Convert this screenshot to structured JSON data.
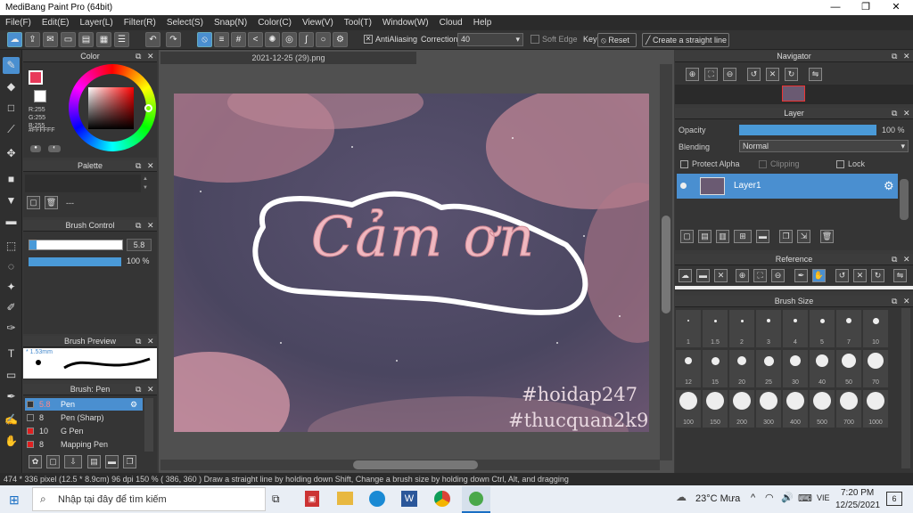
{
  "window": {
    "title": "MediBang Paint Pro (64bit)",
    "minimize": "—",
    "maximize": "❐",
    "close": "✕"
  },
  "menu": [
    "File(F)",
    "Edit(E)",
    "Layer(L)",
    "Filter(R)",
    "Select(S)",
    "Snap(N)",
    "Color(C)",
    "View(V)",
    "Tool(T)",
    "Window(W)",
    "Cloud",
    "Help"
  ],
  "toolbar": {
    "antialias_label": "AntiAliasing",
    "correction_label": "Correction",
    "correction_value": "40",
    "soft_edge_label": "Soft Edge",
    "key_label": "Key",
    "reset_label": "Reset",
    "straight_line_label": "Create a straight line"
  },
  "panels": {
    "color": "Color",
    "palette": "Palette",
    "brush_control": "Brush Control",
    "brush_preview": "Brush Preview",
    "brush_list": "Brush: Pen",
    "navigator": "Navigator",
    "layer": "Layer",
    "reference": "Reference",
    "brush_size": "Brush Size"
  },
  "color": {
    "r": "R:255",
    "g": "G:255",
    "b": "B:255",
    "hex": "#FFFFFF",
    "foreground": "#e83a5a",
    "wheel_selected": "#ff0000"
  },
  "palette": {
    "none_label": "---"
  },
  "brush_control": {
    "size": "5.8",
    "opacity": "100 %",
    "size_fraction": 0.66,
    "opacity_fraction": 1.0
  },
  "brush_preview": {
    "size_label": "* 1.53mm"
  },
  "brushes": [
    {
      "size": "5.8",
      "name": "Pen",
      "color": "#333333",
      "selected": true
    },
    {
      "size": "8",
      "name": "Pen (Sharp)",
      "color": "#333333",
      "selected": false
    },
    {
      "size": "10",
      "name": "G Pen",
      "color": "#e02020",
      "selected": false
    },
    {
      "size": "8",
      "name": "Mapping Pen",
      "color": "#e02020",
      "selected": false
    }
  ],
  "document": {
    "tab": "2021-12-25 (29).png",
    "text_main": "Cảm ơn",
    "watermark1": "#hoidap247",
    "watermark2": "#thucquan2k9"
  },
  "layer": {
    "opacity_label": "Opacity",
    "opacity_value": "100 %",
    "opacity_fraction": 1.0,
    "blending_label": "Blending",
    "blending_value": "Normal",
    "protect_alpha": "Protect Alpha",
    "clipping": "Clipping",
    "lock": "Lock",
    "layer_name": "Layer1"
  },
  "brush_sizes": [
    "1",
    "1.5",
    "2",
    "3",
    "4",
    "5",
    "7",
    "10",
    "12",
    "15",
    "20",
    "25",
    "30",
    "40",
    "50",
    "70",
    "100",
    "150",
    "200",
    "300",
    "400",
    "500",
    "700",
    "1000"
  ],
  "status": {
    "text": "474 * 336 pixel  (12.5 * 8.9cm)  96 dpi  150 %  ( 386, 360 )  Draw a straight line by holding down Shift, Change a brush size by holding down Ctrl, Alt, and dragging"
  },
  "taskbar": {
    "search": "Nhập tại đây để tìm kiếm",
    "temp": "23°C  Mưa",
    "lang": "VIE",
    "time": "7:20 PM",
    "date": "12/25/2021",
    "notif": "6"
  }
}
